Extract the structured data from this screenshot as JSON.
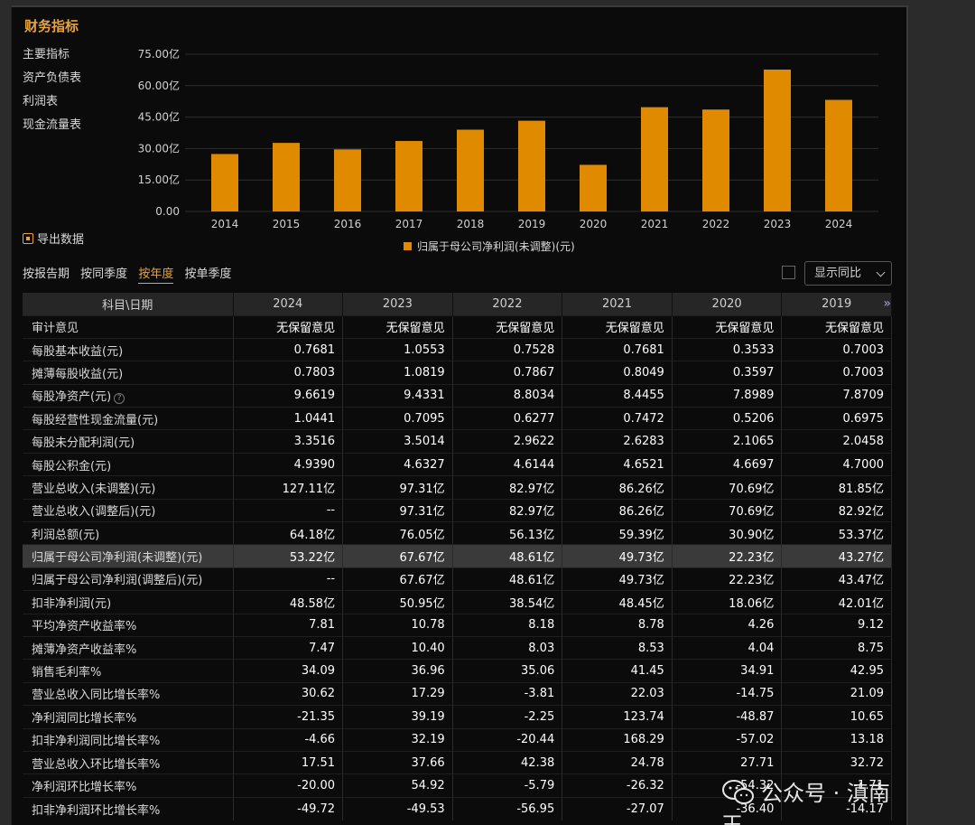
{
  "title": "财务指标",
  "sidebar": {
    "items": [
      {
        "label": "主要指标",
        "active": true
      },
      {
        "label": "资产负债表",
        "active": false
      },
      {
        "label": "利润表",
        "active": false
      },
      {
        "label": "现金流量表",
        "active": false
      }
    ]
  },
  "export_label": "导出数据",
  "legend_label": "归属于母公司净利润(未调整)(元)",
  "tabs": [
    {
      "label": "按报告期",
      "active": false
    },
    {
      "label": "按同季度",
      "active": false
    },
    {
      "label": "按年度",
      "active": true
    },
    {
      "label": "按单季度",
      "active": false
    }
  ],
  "compare_label": "显示同比",
  "table": {
    "header": [
      "科目\\日期",
      "2024",
      "2023",
      "2022",
      "2021",
      "2020",
      "2019"
    ],
    "rows": [
      {
        "label": "审计意见",
        "values": [
          "无保留意见",
          "无保留意见",
          "无保留意见",
          "无保留意见",
          "无保留意见",
          "无保留意见"
        ]
      },
      {
        "label": "每股基本收益(元)",
        "values": [
          "0.7681",
          "1.0553",
          "0.7528",
          "0.7681",
          "0.3533",
          "0.7003"
        ]
      },
      {
        "label": "摊薄每股收益(元)",
        "values": [
          "0.7803",
          "1.0819",
          "0.7867",
          "0.8049",
          "0.3597",
          "0.7003"
        ]
      },
      {
        "label": "每股净资产(元)",
        "values": [
          "9.6619",
          "9.4331",
          "8.8034",
          "8.4455",
          "7.8989",
          "7.8709"
        ],
        "help": true
      },
      {
        "label": "每股经营性现金流量(元)",
        "values": [
          "1.0441",
          "0.7095",
          "0.6277",
          "0.7472",
          "0.5206",
          "0.6975"
        ]
      },
      {
        "label": "每股未分配利润(元)",
        "values": [
          "3.3516",
          "3.5014",
          "2.9622",
          "2.6283",
          "2.1065",
          "2.0458"
        ]
      },
      {
        "label": "每股公积金(元)",
        "values": [
          "4.9390",
          "4.6327",
          "4.6144",
          "4.6521",
          "4.6697",
          "4.7000"
        ]
      },
      {
        "label": "营业总收入(未调整)(元)",
        "values": [
          "127.11亿",
          "97.31亿",
          "82.97亿",
          "86.26亿",
          "70.69亿",
          "81.85亿"
        ]
      },
      {
        "label": "营业总收入(调整后)(元)",
        "values": [
          "--",
          "97.31亿",
          "82.97亿",
          "86.26亿",
          "70.69亿",
          "82.92亿"
        ]
      },
      {
        "label": "利润总额(元)",
        "values": [
          "64.18亿",
          "76.05亿",
          "56.13亿",
          "59.39亿",
          "30.90亿",
          "53.37亿"
        ]
      },
      {
        "label": "归属于母公司净利润(未调整)(元)",
        "values": [
          "53.22亿",
          "67.67亿",
          "48.61亿",
          "49.73亿",
          "22.23亿",
          "43.27亿"
        ],
        "highlight": true
      },
      {
        "label": "归属于母公司净利润(调整后)(元)",
        "values": [
          "--",
          "67.67亿",
          "48.61亿",
          "49.73亿",
          "22.23亿",
          "43.47亿"
        ]
      },
      {
        "label": "扣非净利润(元)",
        "values": [
          "48.58亿",
          "50.95亿",
          "38.54亿",
          "48.45亿",
          "18.06亿",
          "42.01亿"
        ]
      },
      {
        "label": "平均净资产收益率%",
        "values": [
          "7.81",
          "10.78",
          "8.18",
          "8.78",
          "4.26",
          "9.12"
        ]
      },
      {
        "label": "摊薄净资产收益率%",
        "values": [
          "7.47",
          "10.40",
          "8.03",
          "8.53",
          "4.04",
          "8.75"
        ]
      },
      {
        "label": "销售毛利率%",
        "values": [
          "34.09",
          "36.96",
          "35.06",
          "41.45",
          "34.91",
          "42.95"
        ]
      },
      {
        "label": "营业总收入同比增长率%",
        "values": [
          "30.62",
          "17.29",
          "-3.81",
          "22.03",
          "-14.75",
          "21.09"
        ]
      },
      {
        "label": "净利润同比增长率%",
        "values": [
          "-21.35",
          "39.19",
          "-2.25",
          "123.74",
          "-48.87",
          "10.65"
        ]
      },
      {
        "label": "扣非净利润同比增长率%",
        "values": [
          "-4.66",
          "32.19",
          "-20.44",
          "168.29",
          "-57.02",
          "13.18"
        ]
      },
      {
        "label": "营业总收入环比增长率%",
        "values": [
          "17.51",
          "37.66",
          "42.38",
          "24.78",
          "27.71",
          "32.72"
        ]
      },
      {
        "label": "净利润环比增长率%",
        "values": [
          "-20.00",
          "54.92",
          "-5.79",
          "-26.32",
          "-54.32",
          "-1.71"
        ]
      },
      {
        "label": "扣非净利润环比增长率%",
        "values": [
          "-49.72",
          "-49.53",
          "-56.95",
          "-27.07",
          "-36.40",
          "-14.17"
        ]
      }
    ]
  },
  "watermark": "公众号 · 滇南王",
  "colors": {
    "accent": "#e8a33a",
    "bar": "#e08a00",
    "panel": "#0b0b0b"
  },
  "chart_data": {
    "type": "bar",
    "categories": [
      "2014",
      "2015",
      "2016",
      "2017",
      "2018",
      "2019",
      "2020",
      "2021",
      "2022",
      "2023",
      "2024"
    ],
    "series": [
      {
        "name": "归属于母公司净利润(未调整)(元)",
        "values": [
          27.4,
          32.7,
          29.6,
          33.6,
          39.0,
          43.27,
          22.23,
          49.73,
          48.61,
          67.67,
          53.22
        ]
      }
    ],
    "ylim": [
      0,
      75
    ],
    "yticks": [
      "0.00",
      "15.00亿",
      "30.00亿",
      "45.00亿",
      "60.00亿",
      "75.00亿"
    ],
    "ytick_values": [
      0,
      15,
      30,
      45,
      60,
      75
    ],
    "grid": true
  }
}
